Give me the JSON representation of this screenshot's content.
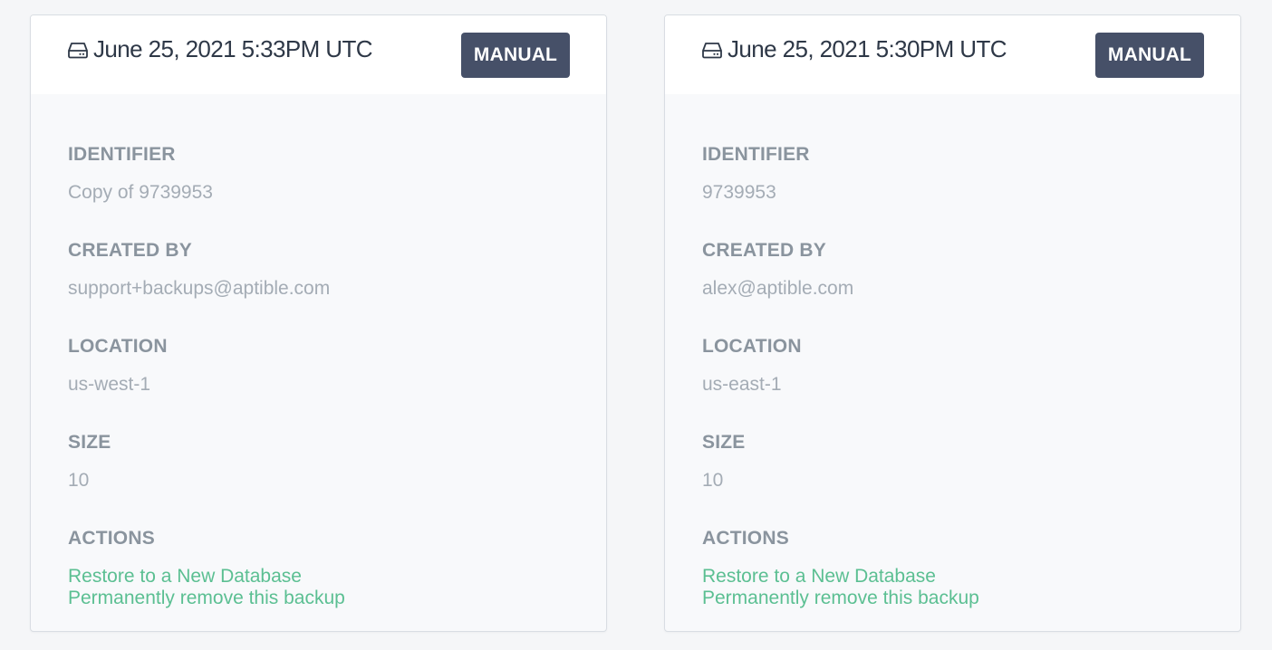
{
  "backups": [
    {
      "timestamp": "June 25, 2021 5:33PM UTC",
      "type_badge": "MANUAL",
      "icon": "hard-drive-icon",
      "fields": {
        "identifier_label": "IDENTIFIER",
        "identifier_value": "Copy of 9739953",
        "created_by_label": "CREATED BY",
        "created_by_value": "support+backups@aptible.com",
        "location_label": "LOCATION",
        "location_value": "us-west-1",
        "size_label": "SIZE",
        "size_value": "10",
        "actions_label": "ACTIONS"
      },
      "actions": {
        "restore": "Restore to a New Database",
        "remove": "Permanently remove this backup"
      }
    },
    {
      "timestamp": "June 25, 2021 5:30PM UTC",
      "type_badge": "MANUAL",
      "icon": "hard-drive-icon",
      "fields": {
        "identifier_label": "IDENTIFIER",
        "identifier_value": "9739953",
        "created_by_label": "CREATED BY",
        "created_by_value": "alex@aptible.com",
        "location_label": "LOCATION",
        "location_value": "us-east-1",
        "size_label": "SIZE",
        "size_value": "10",
        "actions_label": "ACTIONS"
      },
      "actions": {
        "restore": "Restore to a New Database",
        "remove": "Permanently remove this backup"
      }
    }
  ],
  "colors": {
    "badge_bg": "#465068",
    "link": "#5bbf92",
    "label": "#8a949e",
    "value": "#a4acb5",
    "title": "#2e3847"
  }
}
